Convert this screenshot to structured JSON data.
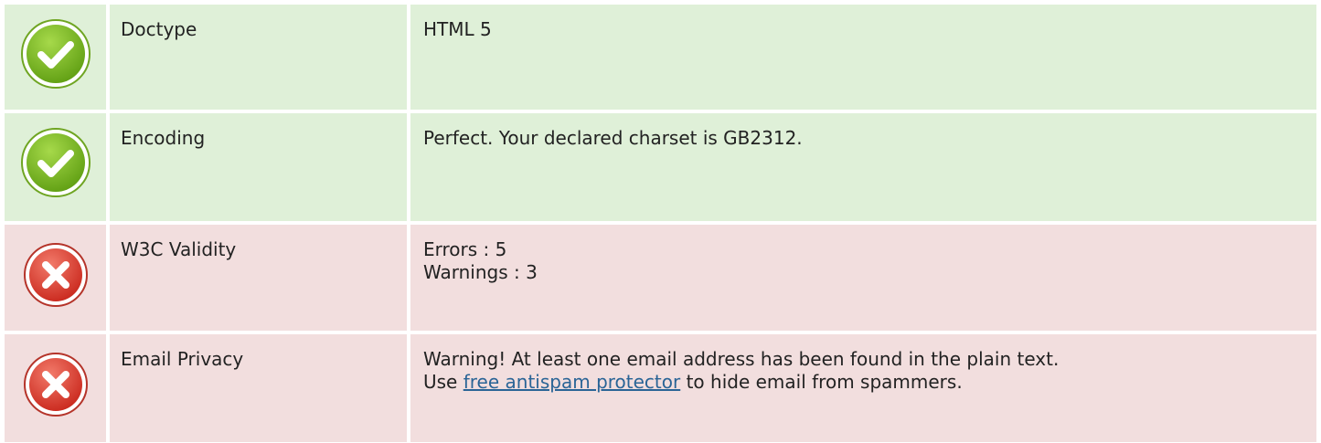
{
  "colors": {
    "pass_bg": "#dff0d8",
    "fail_bg": "#f2dede",
    "pass_icon": "#7dbb1f",
    "fail_icon": "#e03c32",
    "link": "#2a6496"
  },
  "rows": [
    {
      "status": "pass",
      "icon": "check-circle-icon",
      "name": "Doctype",
      "value_lines": [
        "HTML 5"
      ]
    },
    {
      "status": "pass",
      "icon": "check-circle-icon",
      "name": "Encoding",
      "value_lines": [
        "Perfect. Your declared charset is GB2312."
      ]
    },
    {
      "status": "fail",
      "icon": "cross-circle-icon",
      "name": "W3C Validity",
      "value_lines": [
        "Errors : 5",
        "Warnings : 3"
      ]
    },
    {
      "status": "fail",
      "icon": "cross-circle-icon",
      "name": "Email Privacy",
      "value_lines": [
        "Warning! At least one email address has been found in the plain text."
      ],
      "line2_prefix": "Use ",
      "line2_link": "free antispam protector",
      "line2_suffix": " to hide email from spammers."
    }
  ]
}
